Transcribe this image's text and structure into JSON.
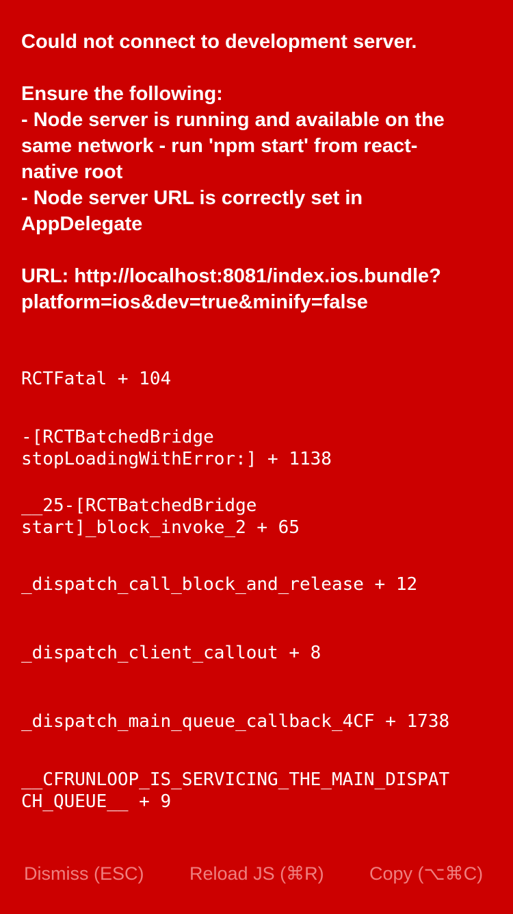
{
  "message": {
    "lines": [
      "Could not connect to development server.",
      "",
      "Ensure the following:",
      "- Node server is running and available on the",
      "same network - run 'npm start' from react-",
      "native root",
      "- Node server URL is correctly set in",
      "AppDelegate",
      "",
      "URL: http://localhost:8081/index.ios.bundle?",
      "platform=ios&dev=true&minify=false"
    ]
  },
  "stack": [
    {
      "lines": [
        "RCTFatal + 104"
      ]
    },
    {
      "lines": [
        "-[RCTBatchedBridge",
        "stopLoadingWithError:] + 1138"
      ]
    },
    {
      "lines": [
        "__25-[RCTBatchedBridge",
        "start]_block_invoke_2 + 65"
      ]
    },
    {
      "lines": [
        "_dispatch_call_block_and_release + 12"
      ]
    },
    {
      "lines": [
        "_dispatch_client_callout + 8"
      ]
    },
    {
      "lines": [
        "_dispatch_main_queue_callback_4CF + 1738"
      ]
    },
    {
      "lines": [
        "__CFRUNLOOP_IS_SERVICING_THE_MAIN_DISPAT",
        "CH_QUEUE__ + 9"
      ]
    }
  ],
  "actions": {
    "dismiss": "Dismiss (ESC)",
    "reload": "Reload JS (⌘R)",
    "copy": "Copy (⌥⌘C)"
  },
  "colors": {
    "background": "#cc0000",
    "text": "#ffffff",
    "action_text": "#ef7f7f"
  }
}
